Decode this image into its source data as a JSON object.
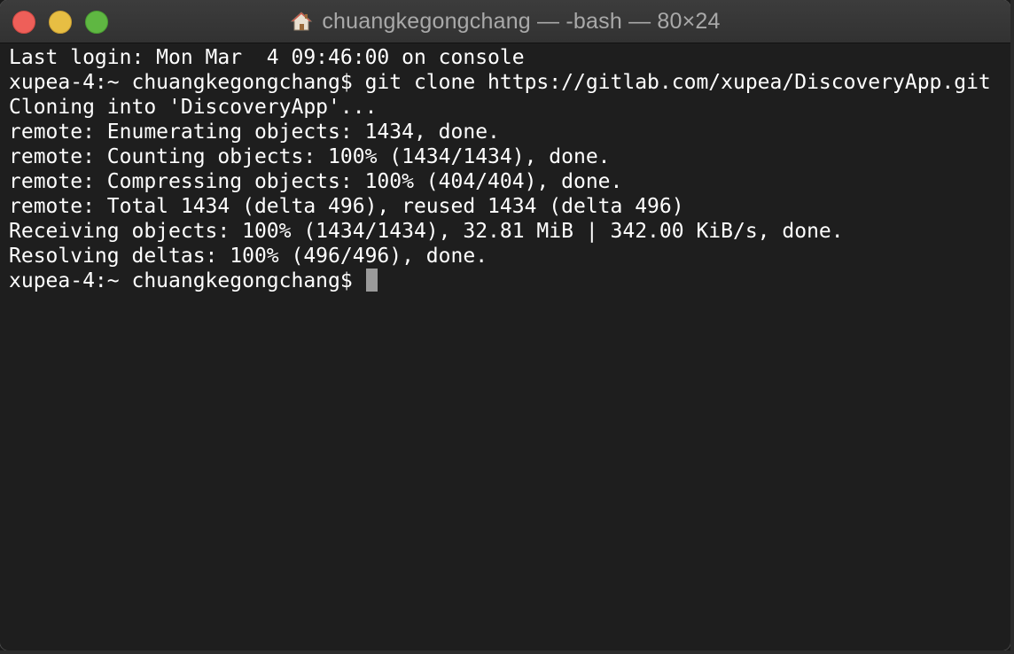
{
  "window": {
    "title": "chuangkegongchang — -bash — 80×24",
    "title_icon": "home-icon"
  },
  "traffic_lights": {
    "close_color": "#ee5f59",
    "minimize_color": "#e7be43",
    "zoom_color": "#5fb742"
  },
  "terminal": {
    "lines": [
      "Last login: Mon Mar  4 09:46:00 on console",
      "xupea-4:~ chuangkegongchang$ git clone https://gitlab.com/xupea/DiscoveryApp.git",
      "Cloning into 'DiscoveryApp'...",
      "remote: Enumerating objects: 1434, done.",
      "remote: Counting objects: 100% (1434/1434), done.",
      "remote: Compressing objects: 100% (404/404), done.",
      "remote: Total 1434 (delta 496), reused 1434 (delta 496)",
      "Receiving objects: 100% (1434/1434), 32.81 MiB | 342.00 KiB/s, done.",
      "Resolving deltas: 100% (496/496), done."
    ],
    "prompt": "xupea-4:~ chuangkegongchang$ ",
    "background_color": "#1e1e1e",
    "text_color": "#ffffff"
  }
}
